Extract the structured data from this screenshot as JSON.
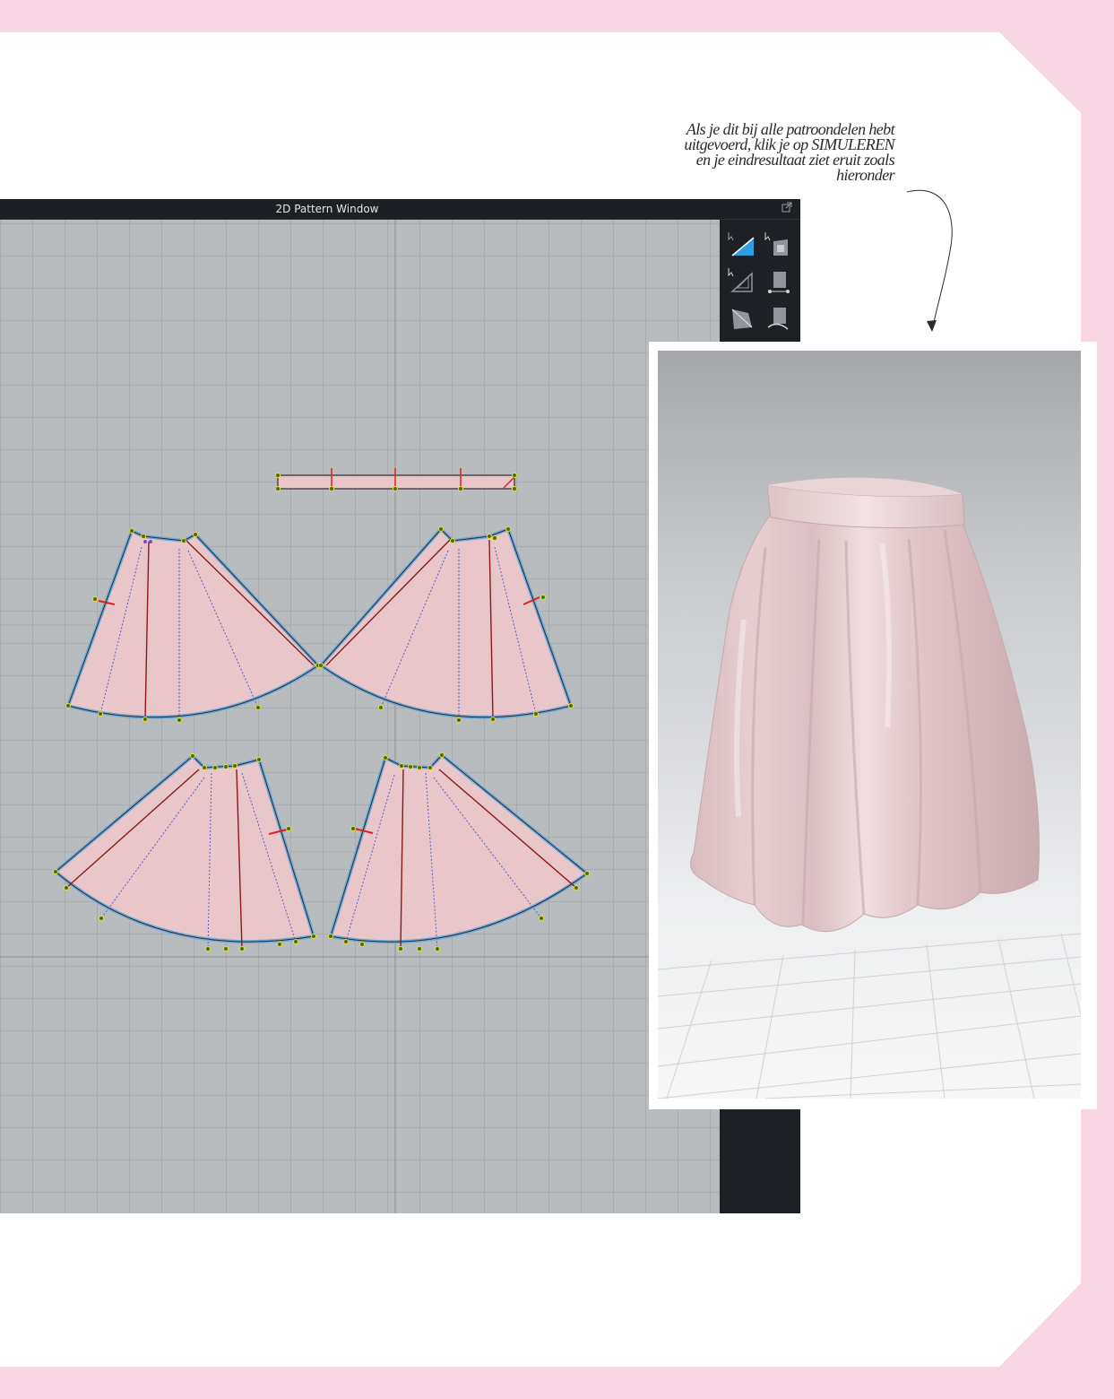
{
  "caption": {
    "lines": [
      "Als je dit bij alle patroondelen hebt",
      "uitgevoerd, klik je op SIMULEREN",
      "en je eindresultaat ziet eruit zoals",
      "hieronder"
    ]
  },
  "window": {
    "title": "2D Pattern Window"
  },
  "toolbar": {
    "tools": [
      {
        "icon": "select-pattern-icon",
        "active": true
      },
      {
        "icon": "transform-pattern-icon",
        "active": false
      },
      {
        "icon": "edit-pattern-icon",
        "active": false
      },
      {
        "icon": "edit-curvature-icon",
        "active": false
      },
      {
        "icon": "polygon-icon",
        "active": false
      },
      {
        "icon": "curve-point-icon",
        "active": false
      },
      {
        "icon": "rectangle-icon",
        "active": false
      },
      {
        "icon": "circle-icon",
        "active": false
      }
    ]
  },
  "colors": {
    "page_border": "#f8d6e3",
    "pattern_fill": "#e8c6c9",
    "pattern_outline": "#6fa9d8",
    "canvas_bg": "#b9bcbe",
    "grid_line": "#a9acaf",
    "toolbar_bg": "#1d2024",
    "active_tool": "#2e9fe0",
    "skirt_fill": "#e8cfd1"
  }
}
